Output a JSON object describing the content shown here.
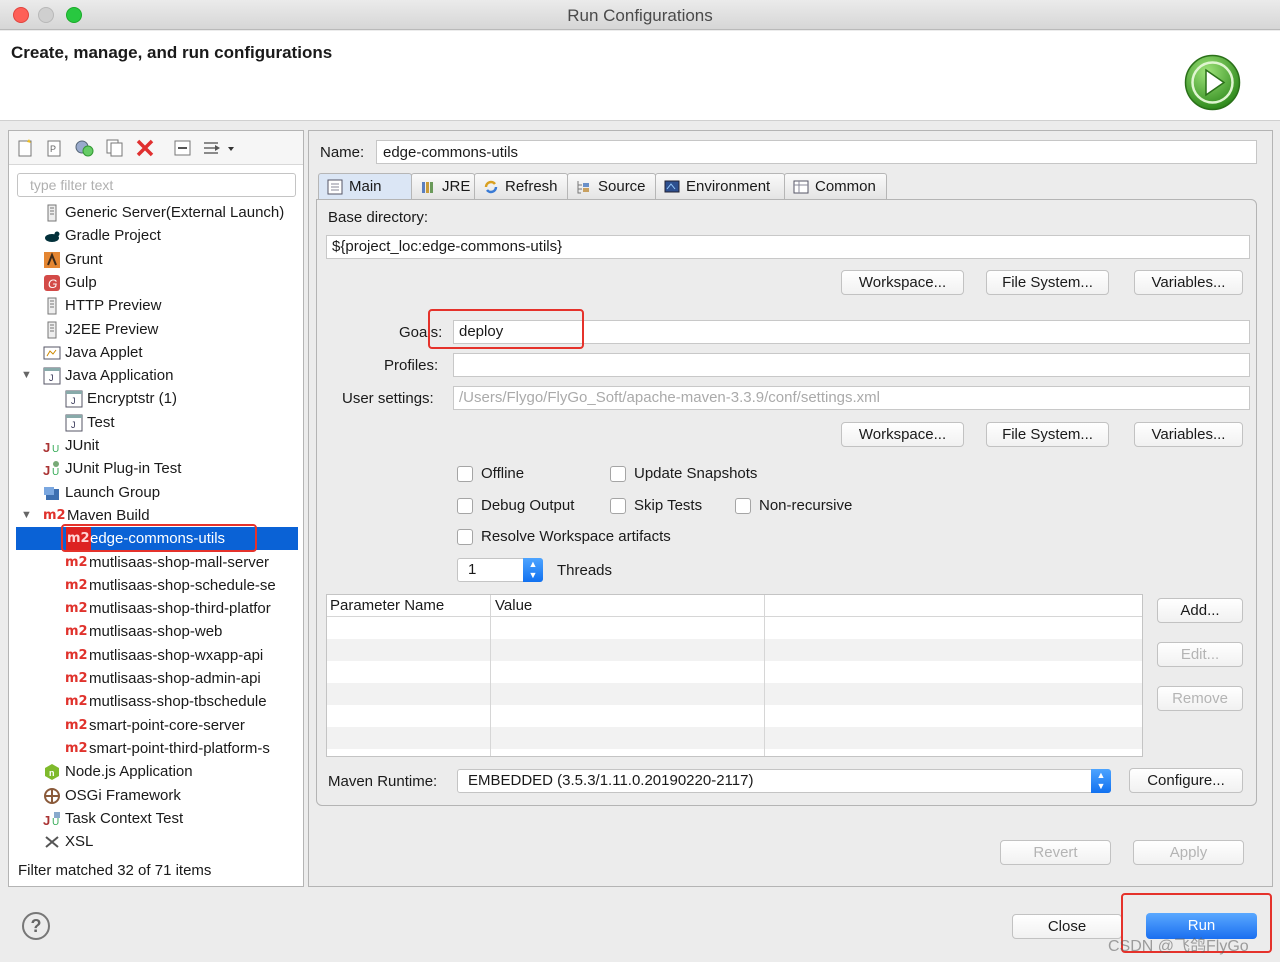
{
  "window": {
    "title": "Run Configurations"
  },
  "header": {
    "title": "Create, manage, and run configurations"
  },
  "left": {
    "filter_placeholder": "type filter text",
    "status": "Filter matched 32 of 71 items",
    "tree": [
      {
        "label": "Generic Server(External Launch)",
        "icon": "server-icon"
      },
      {
        "label": "Gradle Project",
        "icon": "gradle-icon"
      },
      {
        "label": "Grunt",
        "icon": "grunt-icon"
      },
      {
        "label": "Gulp",
        "icon": "gulp-icon"
      },
      {
        "label": "HTTP Preview",
        "icon": "server-icon"
      },
      {
        "label": "J2EE Preview",
        "icon": "server-icon"
      },
      {
        "label": "Java Applet",
        "icon": "applet-icon"
      },
      {
        "label": "Java Application",
        "icon": "java-app-icon"
      },
      {
        "label": "Encryptstr (1)",
        "icon": "java-file-icon"
      },
      {
        "label": "Test",
        "icon": "java-file-icon"
      },
      {
        "label": "JUnit",
        "icon": "junit-icon"
      },
      {
        "label": "JUnit Plug-in Test",
        "icon": "junit-plugin-icon"
      },
      {
        "label": "Launch Group",
        "icon": "launch-group-icon"
      },
      {
        "label": "Maven Build",
        "icon": "maven-icon"
      },
      {
        "label": "edge-commons-utils",
        "icon": "maven-icon"
      },
      {
        "label": "mutlisaas-shop-mall-server",
        "icon": "maven-icon"
      },
      {
        "label": "mutlisaas-shop-schedule-se",
        "icon": "maven-icon"
      },
      {
        "label": "mutlisaas-shop-third-platfor",
        "icon": "maven-icon"
      },
      {
        "label": "mutlisaas-shop-web",
        "icon": "maven-icon"
      },
      {
        "label": "mutlisaas-shop-wxapp-api",
        "icon": "maven-icon"
      },
      {
        "label": "mutlisaas-shop-admin-api",
        "icon": "maven-icon"
      },
      {
        "label": "mutlisass-shop-tbschedule",
        "icon": "maven-icon"
      },
      {
        "label": "smart-point-core-server",
        "icon": "maven-icon"
      },
      {
        "label": "smart-point-third-platform-s",
        "icon": "maven-icon"
      },
      {
        "label": "Node.js Application",
        "icon": "nodejs-icon"
      },
      {
        "label": "OSGi Framework",
        "icon": "osgi-icon"
      },
      {
        "label": "Task Context Test",
        "icon": "task-context-icon"
      },
      {
        "label": "XSL",
        "icon": "xsl-icon"
      }
    ],
    "maven_prefix": "m2"
  },
  "config": {
    "name_label": "Name:",
    "name_value": "edge-commons-utils",
    "tabs": [
      "Main",
      "JRE",
      "Refresh",
      "Source",
      "Environment",
      "Common"
    ],
    "base_dir_label": "Base directory:",
    "base_dir_value": "${project_loc:edge-commons-utils}",
    "workspace_btn": "Workspace...",
    "filesystem_btn": "File System...",
    "variables_btn": "Variables...",
    "goals_label": "Goals:",
    "goals_value": "deploy",
    "profiles_label": "Profiles:",
    "profiles_value": "",
    "user_settings_label": "User settings:",
    "user_settings_value": "/Users/Flygo/FlyGo_Soft/apache-maven-3.3.9/conf/settings.xml",
    "checkboxes": {
      "offline": "Offline",
      "update_snapshots": "Update Snapshots",
      "debug_output": "Debug Output",
      "skip_tests": "Skip Tests",
      "non_recursive": "Non-recursive",
      "resolve_workspace": "Resolve Workspace artifacts"
    },
    "threads_value": "1",
    "threads_label": "Threads",
    "table": {
      "col_name": "Parameter Name",
      "col_value": "Value"
    },
    "add_btn": "Add...",
    "edit_btn": "Edit...",
    "remove_btn": "Remove",
    "runtime_label": "Maven Runtime:",
    "runtime_value": "EMBEDDED (3.5.3/1.11.0.20190220-2117)",
    "configure_btn": "Configure...",
    "revert_btn": "Revert",
    "apply_btn": "Apply"
  },
  "footer": {
    "help": "?",
    "close_btn": "Close",
    "run_btn": "Run",
    "watermark": "CSDN @飞鸽FlyGo"
  },
  "colors": {
    "accent": "#1a6ff0",
    "selection": "#0a62d6",
    "highlight": "#e5322b",
    "maven": "#e0322c"
  }
}
